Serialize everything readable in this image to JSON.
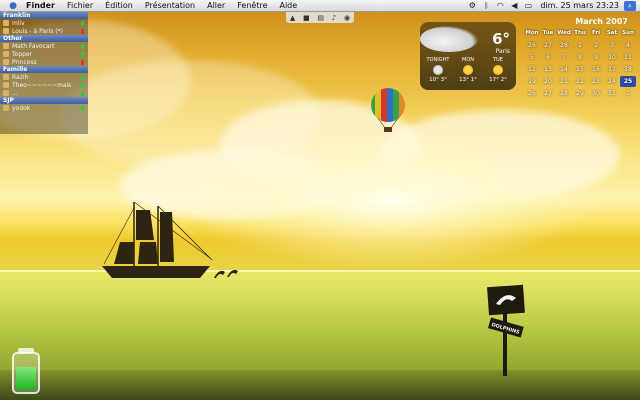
{
  "menubar": {
    "items": [
      "Finder",
      "Fichier",
      "Édition",
      "Présentation",
      "Aller",
      "Fenêtre",
      "Aide"
    ],
    "clock": "dim. 25 mars 23:23",
    "status_icons": [
      "gear-icon",
      "bluetooth-icon",
      "wifi-icon",
      "volume-icon",
      "battery-icon"
    ]
  },
  "buddy_list": {
    "groups": [
      {
        "name": "Franklin",
        "buddies": [
          {
            "name": "mliv",
            "status": "online"
          },
          {
            "name": "Louis - à Paris (*)",
            "status": "away"
          }
        ]
      },
      {
        "name": "Other",
        "buddies": [
          {
            "name": "Math Favocart",
            "status": "online"
          },
          {
            "name": "Topper",
            "status": "online"
          },
          {
            "name": "Princess",
            "status": "away"
          }
        ]
      },
      {
        "name": "Famille",
        "buddies": [
          {
            "name": "Razih",
            "status": "online"
          },
          {
            "name": "Theo~~~~~~mais",
            "status": "online"
          },
          {
            "name": "...",
            "status": "online"
          }
        ]
      },
      {
        "name": "SJP",
        "buddies": [
          {
            "name": "yodok",
            "status": "online"
          }
        ]
      }
    ]
  },
  "weather": {
    "temp": "6°",
    "city": "Paris",
    "days": [
      {
        "label": "TONIGHT",
        "temps": "10° 3°"
      },
      {
        "label": "MON",
        "temps": "13° 1°"
      },
      {
        "label": "TUE",
        "temps": "17° 2°"
      }
    ]
  },
  "calendar": {
    "title": "March 2007",
    "weekdays": [
      "Mon",
      "Tue",
      "Wed",
      "Thu",
      "Fri",
      "Sat",
      "Sun"
    ],
    "cells": [
      "26",
      "27",
      "28",
      "1",
      "2",
      "3",
      "4",
      "5",
      "6",
      "7",
      "8",
      "9",
      "10",
      "11",
      "12",
      "13",
      "14",
      "15",
      "16",
      "17",
      "18",
      "19",
      "20",
      "21",
      "22",
      "23",
      "24",
      "25",
      "26",
      "27",
      "28",
      "29",
      "30",
      "31",
      "1"
    ],
    "today": "25"
  },
  "sign": {
    "text": "DOLPHINS"
  },
  "battery": {
    "charge": 0.65
  },
  "colors": {
    "accent": "#2a4fa8",
    "menubar": "#e8e8e8",
    "online": "#3cc13c",
    "away": "#d43b2a"
  }
}
